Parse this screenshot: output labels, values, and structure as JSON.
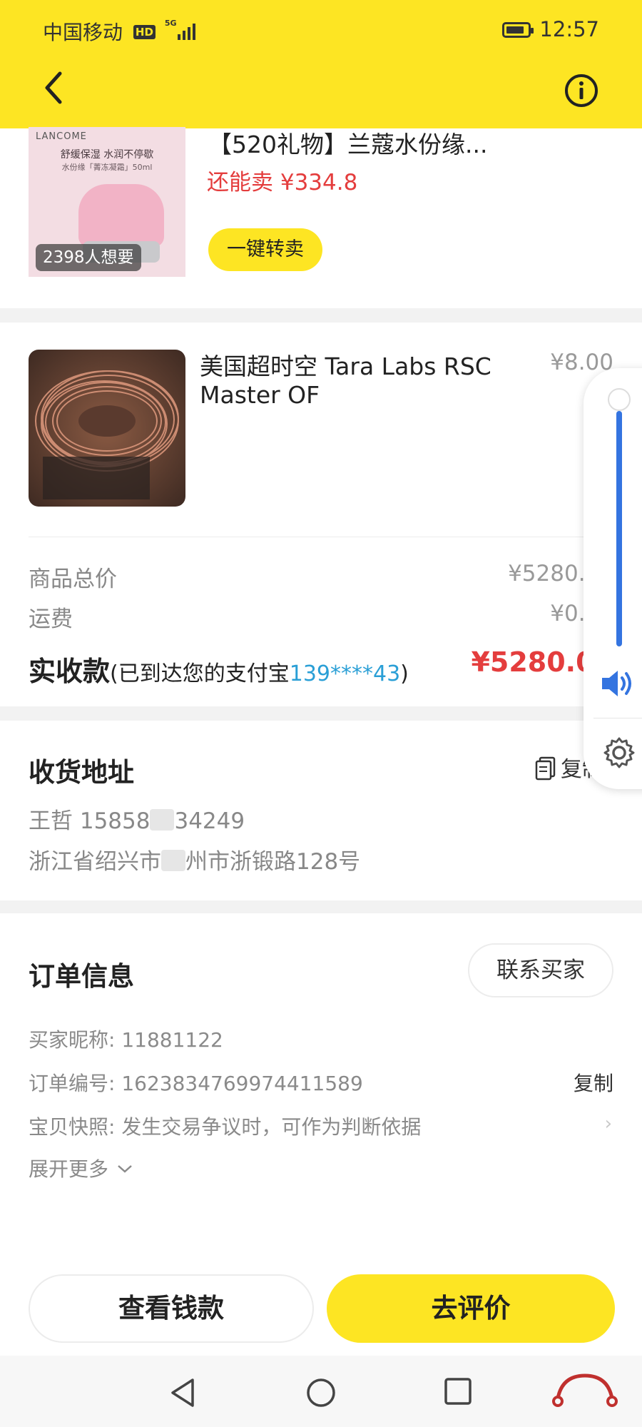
{
  "status_bar": {
    "carrier": "中国移动",
    "hd": "HD",
    "network": "5G",
    "time": "12:57"
  },
  "product_card": {
    "image_brand": "LANCOME",
    "image_tagline": "舒缓保湿 水润不停歇",
    "image_subline": "水份缘「菁冻凝霜」50ml",
    "want_count": "2398人想要",
    "title": "【520礼物】兰蔻水份缘...",
    "resell_price": "还能卖 ¥334.8",
    "resell_button": "一键转卖"
  },
  "order_item": {
    "title": "美国超时空 Tara Labs RSC Master  OF",
    "price": "¥8.00",
    "subtotal_label": "商品总价",
    "subtotal_value": "¥5280.00",
    "shipping_label": "运费",
    "shipping_value": "¥0.00",
    "received_label": "实收款",
    "received_desc": "(已到达您的支付宝",
    "received_account": "139****43",
    "received_close": ")",
    "received_total": "¥5280.00"
  },
  "address": {
    "title": "收货地址",
    "copy_label": "复制",
    "name_phone_prefix": "王哲 15858",
    "name_phone_suffix": "34249",
    "addr_prefix": "浙江省绍兴市",
    "addr_suffix": "州市浙锻路128号"
  },
  "order_info": {
    "title": "订单信息",
    "contact_button": "联系买家",
    "buyer": "买家昵称: 11881122",
    "order_no": "订单编号: 1623834769974411589",
    "copy_label": "复制",
    "snapshot": "宝贝快照: 发生交易争议时，可作为判断依据",
    "expand": "展开更多"
  },
  "actions": {
    "view_money": "查看钱款",
    "review": "去评价"
  },
  "volume": {
    "level": 1.0
  },
  "colors": {
    "brand_yellow": "#fde523",
    "price_red": "#e43d3d",
    "link_blue": "#2a9fd6",
    "volume_blue": "#3474e0"
  },
  "icons": [
    "back-icon",
    "info-icon",
    "copy-icon",
    "chevron-right-icon",
    "chevron-down-icon",
    "volume-icon",
    "settings-icon",
    "nav-back-icon",
    "nav-home-icon",
    "nav-recent-icon",
    "battery-icon",
    "signal-icon"
  ]
}
